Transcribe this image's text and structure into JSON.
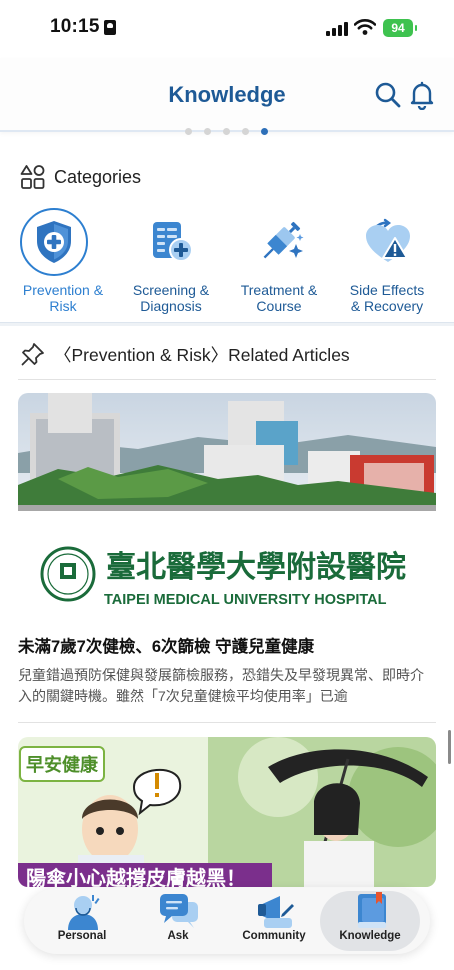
{
  "status_bar": {
    "time": "10:15",
    "battery": "94"
  },
  "header": {
    "title": "Knowledge"
  },
  "pager": {
    "count": 5,
    "active_index": 4
  },
  "categories_section": {
    "title": "Categories",
    "items": [
      {
        "label": "Prevention & Risk",
        "icon": "shield-plus-icon",
        "selected": true
      },
      {
        "label": "Screening & Diagnosis",
        "icon": "clipboard-plus-icon",
        "selected": false
      },
      {
        "label": "Treatment & Course",
        "icon": "syringe-sparkle-icon",
        "selected": false
      },
      {
        "label": "Side Effects & Recovery",
        "icon": "heart-alert-icon",
        "selected": false
      }
    ]
  },
  "articles_section": {
    "title": "〈Prevention & Risk〉Related Articles",
    "articles": [
      {
        "image_caption_cn": "臺北醫學大學附設醫院",
        "image_caption_en": "TAIPEI MEDICAL UNIVERSITY HOSPITAL",
        "title": "未滿7歲7次健檢、6次篩檢 守護兒童健康",
        "excerpt": "兒童錯過預防保健與發展篩檢服務，恐錯失及早發現異常、即時介入的關鍵時機。雖然「7次兒童健檢平均使用率」已逾"
      },
      {
        "image_badge": "早安健康",
        "image_banner": "陽傘小心越撐皮膚越黑！",
        "title": "",
        "excerpt": ""
      }
    ]
  },
  "bottom_nav": {
    "items": [
      {
        "label": "Personal",
        "icon": "person-icon",
        "active": false
      },
      {
        "label": "Ask",
        "icon": "chat-bubbles-icon",
        "active": false
      },
      {
        "label": "Community",
        "icon": "megaphone-pen-icon",
        "active": false
      },
      {
        "label": "Knowledge",
        "icon": "book-icon",
        "active": true
      }
    ]
  },
  "colors": {
    "brand": "#1e5a96",
    "accent": "#2d7fd0",
    "battery": "#3ec24f"
  }
}
